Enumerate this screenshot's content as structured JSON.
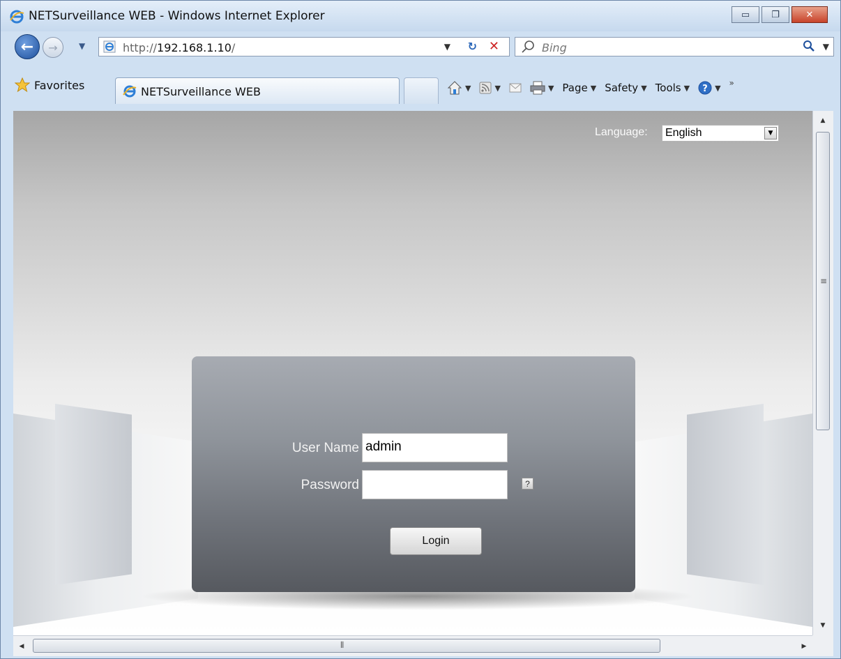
{
  "window": {
    "title": "NETSurveillance WEB - Windows Internet Explorer",
    "min_icon": "minimize-icon",
    "max_icon": "restore-icon",
    "close_icon": "close-icon",
    "min_glyph": "▭",
    "max_glyph": "❐",
    "close_glyph": "✕"
  },
  "nav": {
    "address_prefix": "http://",
    "address_host": "192.168.1.10",
    "address_suffix": "/",
    "search_placeholder": "Bing",
    "back_glyph": "←",
    "forward_glyph": "→",
    "dropdown_glyph": "▼",
    "refresh_glyph": "↻",
    "stop_glyph": "✕"
  },
  "command_bar": {
    "favorites_label": "Favorites",
    "tab_title": "NETSurveillance WEB",
    "page_label": "Page",
    "safety_label": "Safety",
    "tools_label": "Tools",
    "menu_arrow": "▼",
    "overflow": "»"
  },
  "page": {
    "language_label": "Language:",
    "language_value": "English",
    "language_arrow": "▼",
    "username_label": "User Name",
    "username_value": "admin",
    "password_label": "Password",
    "password_value": "",
    "help_label": "?",
    "login_label": "Login"
  },
  "scrollbars": {
    "up": "▲",
    "down": "▼",
    "left": "◀",
    "right": "▶",
    "v_grip": "≡",
    "h_grip": "⦀"
  },
  "colors": {
    "ie_accent": "#1d4f9c",
    "panel_top": "#a7abb2",
    "panel_bottom": "#56595f",
    "stop_red": "#cc2222"
  }
}
